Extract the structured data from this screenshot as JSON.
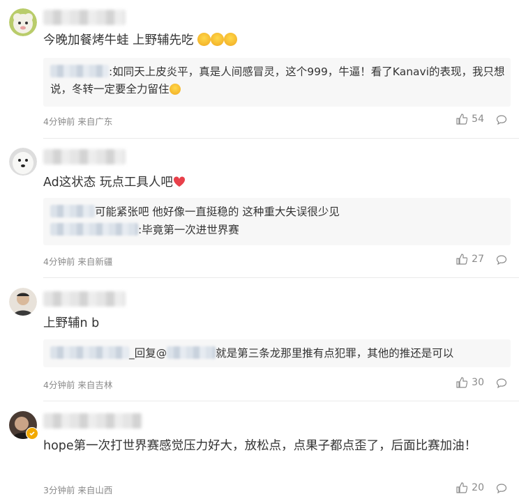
{
  "comments": [
    {
      "text": "今晚加餐烤牛蛙 上野辅先吃",
      "reply": ":如同天上皮炎平，真是人间感冒灵，这个999，牛逼！看了Kanavi的表现，我只想说，冬转一定要全力留住",
      "meta": "4分钟前 来自广东",
      "likes": "54"
    },
    {
      "text": "Ad这状态 玩点工具人吧",
      "reply1": "可能紧张吧 他好像一直挺稳的 这种重大失误很少见",
      "reply2": ":毕竟第一次进世界赛",
      "meta": "4分钟前 来自新疆",
      "likes": "27"
    },
    {
      "text": "上野辅n b",
      "reply_prefix": "_回复@",
      "reply": "就是第三条龙那里推有点犯罪，其他的推还是可以",
      "meta": "4分钟前 来自吉林",
      "likes": "30"
    },
    {
      "text": "hope第一次打世界赛感觉压力好大，放松点，点果子都点歪了，后面比赛加油！",
      "meta": "3分钟前 来自山西",
      "likes": "20"
    }
  ],
  "colors": {
    "heart": "#e8404a",
    "verified": "#f2a900"
  }
}
